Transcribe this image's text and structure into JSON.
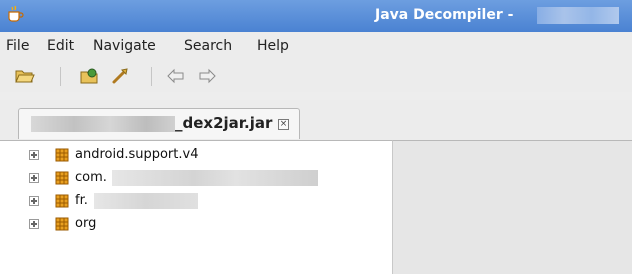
{
  "window": {
    "title": "Java Decompiler -"
  },
  "menu": [
    "File",
    "Edit",
    "Navigate",
    "Search",
    "Help"
  ],
  "toolbar": {
    "buttons": [
      "open-file-icon",
      "open-type-icon",
      "search-icon",
      "back-icon",
      "forward-icon"
    ]
  },
  "tab": {
    "label": "_dex2jar.jar",
    "close_icon": "close-icon"
  },
  "tree": {
    "items": [
      {
        "label": "android.support.v4"
      },
      {
        "label": "com."
      },
      {
        "label": "fr."
      },
      {
        "label": "org"
      }
    ]
  }
}
